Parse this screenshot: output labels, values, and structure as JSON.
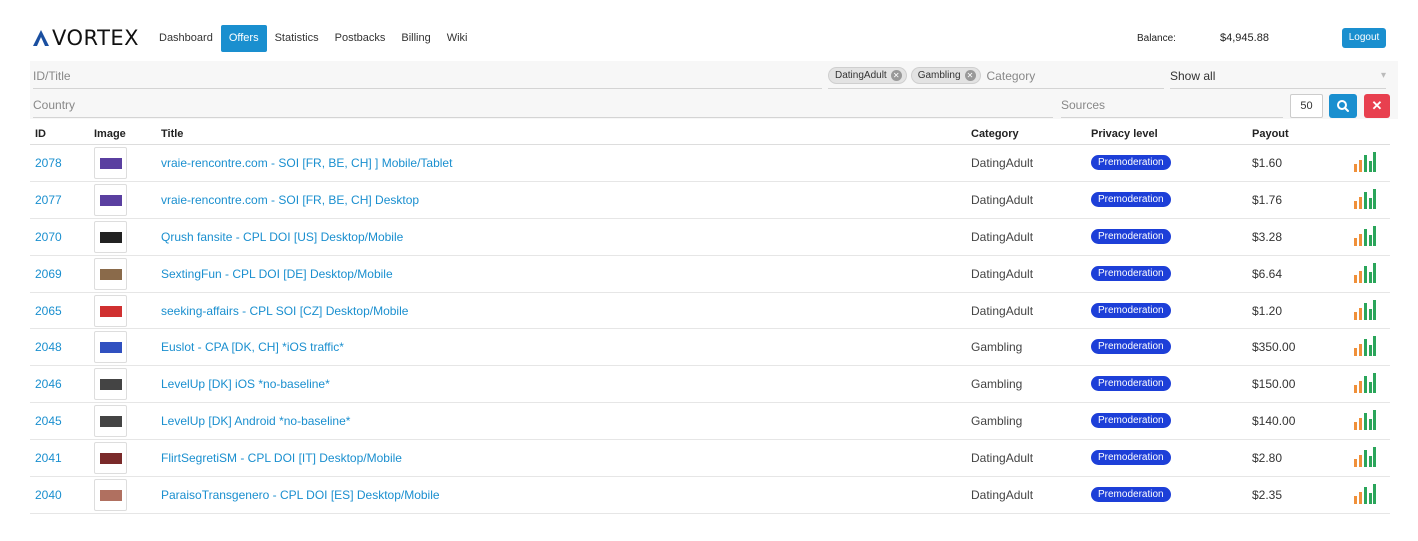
{
  "header": {
    "logo_text": "VORTEX",
    "nav": [
      {
        "label": "Dashboard",
        "active": false
      },
      {
        "label": "Offers",
        "active": true
      },
      {
        "label": "Statistics",
        "active": false
      },
      {
        "label": "Postbacks",
        "active": false
      },
      {
        "label": "Billing",
        "active": false
      },
      {
        "label": "Wiki",
        "active": false
      }
    ],
    "balance_label": "Balance:",
    "balance_value": "$4,945.88",
    "logout_label": "Logout"
  },
  "filters": {
    "id_title_placeholder": "ID/Title",
    "category_chips": [
      "DatingAdult",
      "Gambling"
    ],
    "category_placeholder": "Category",
    "show_value": "Show all",
    "country_placeholder": "Country",
    "sources_placeholder": "Sources",
    "per_page": "50"
  },
  "table": {
    "columns": [
      "ID",
      "Image",
      "Title",
      "Category",
      "Privacy level",
      "Payout"
    ],
    "rows": [
      {
        "id": "2078",
        "title": "vraie-rencontre.com - SOI [FR, BE, CH] ] Mobile/Tablet",
        "category": "DatingAdult",
        "privacy": "Premoderation",
        "payout": "$1.60"
      },
      {
        "id": "2077",
        "title": "vraie-rencontre.com - SOI [FR, BE, CH] Desktop",
        "category": "DatingAdult",
        "privacy": "Premoderation",
        "payout": "$1.76"
      },
      {
        "id": "2070",
        "title": "Qrush fansite - CPL DOI [US] Desktop/Mobile",
        "category": "DatingAdult",
        "privacy": "Premoderation",
        "payout": "$3.28"
      },
      {
        "id": "2069",
        "title": "SextingFun - CPL DOI [DE] Desktop/Mobile",
        "category": "DatingAdult",
        "privacy": "Premoderation",
        "payout": "$6.64"
      },
      {
        "id": "2065",
        "title": "seeking-affairs - CPL SOI [CZ] Desktop/Mobile",
        "category": "DatingAdult",
        "privacy": "Premoderation",
        "payout": "$1.20"
      },
      {
        "id": "2048",
        "title": "Euslot - CPA [DK, CH] *iOS traffic*",
        "category": "Gambling",
        "privacy": "Premoderation",
        "payout": "$350.00"
      },
      {
        "id": "2046",
        "title": "LevelUp [DK] iOS *no-baseline*",
        "category": "Gambling",
        "privacy": "Premoderation",
        "payout": "$150.00"
      },
      {
        "id": "2045",
        "title": "LevelUp [DK] Android *no-baseline*",
        "category": "Gambling",
        "privacy": "Premoderation",
        "payout": "$140.00"
      },
      {
        "id": "2041",
        "title": "FlirtSegretiSM - CPL DOI [IT] Desktop/Mobile",
        "category": "DatingAdult",
        "privacy": "Premoderation",
        "payout": "$2.80"
      },
      {
        "id": "2040",
        "title": "ParaisoTransgenero - CPL DOI [ES] Desktop/Mobile",
        "category": "DatingAdult",
        "privacy": "Premoderation",
        "payout": "$2.35"
      }
    ]
  },
  "colors": {
    "accent": "#1a8fcf",
    "badge": "#1d3fd8",
    "danger": "#e8404f",
    "stat_orange": "#f0903a",
    "stat_green": "#2aa55a"
  }
}
